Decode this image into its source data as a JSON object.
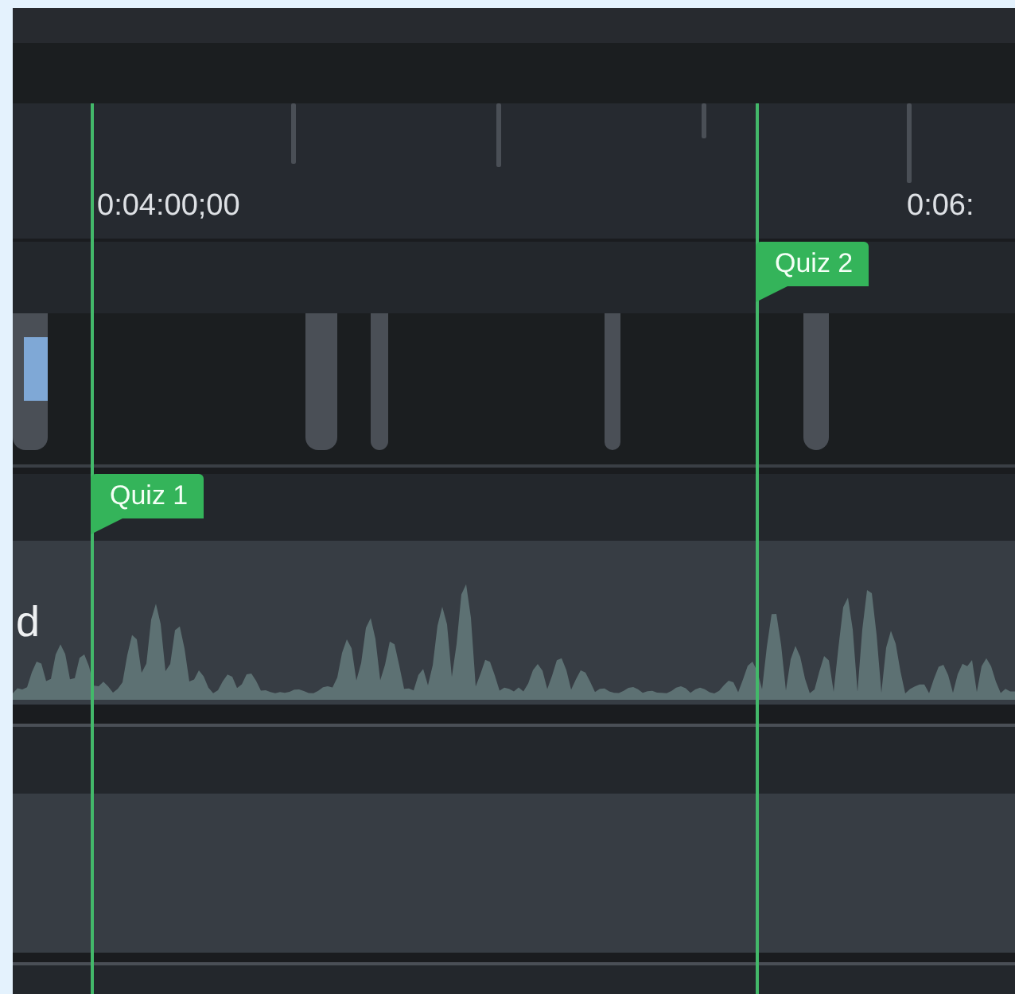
{
  "ruler": {
    "timecodes": [
      "0:04:00;00",
      "0:06:"
    ]
  },
  "markers": [
    {
      "label": "Quiz 1"
    },
    {
      "label": "Quiz 2"
    }
  ],
  "audio_track": {
    "label": "d"
  }
}
